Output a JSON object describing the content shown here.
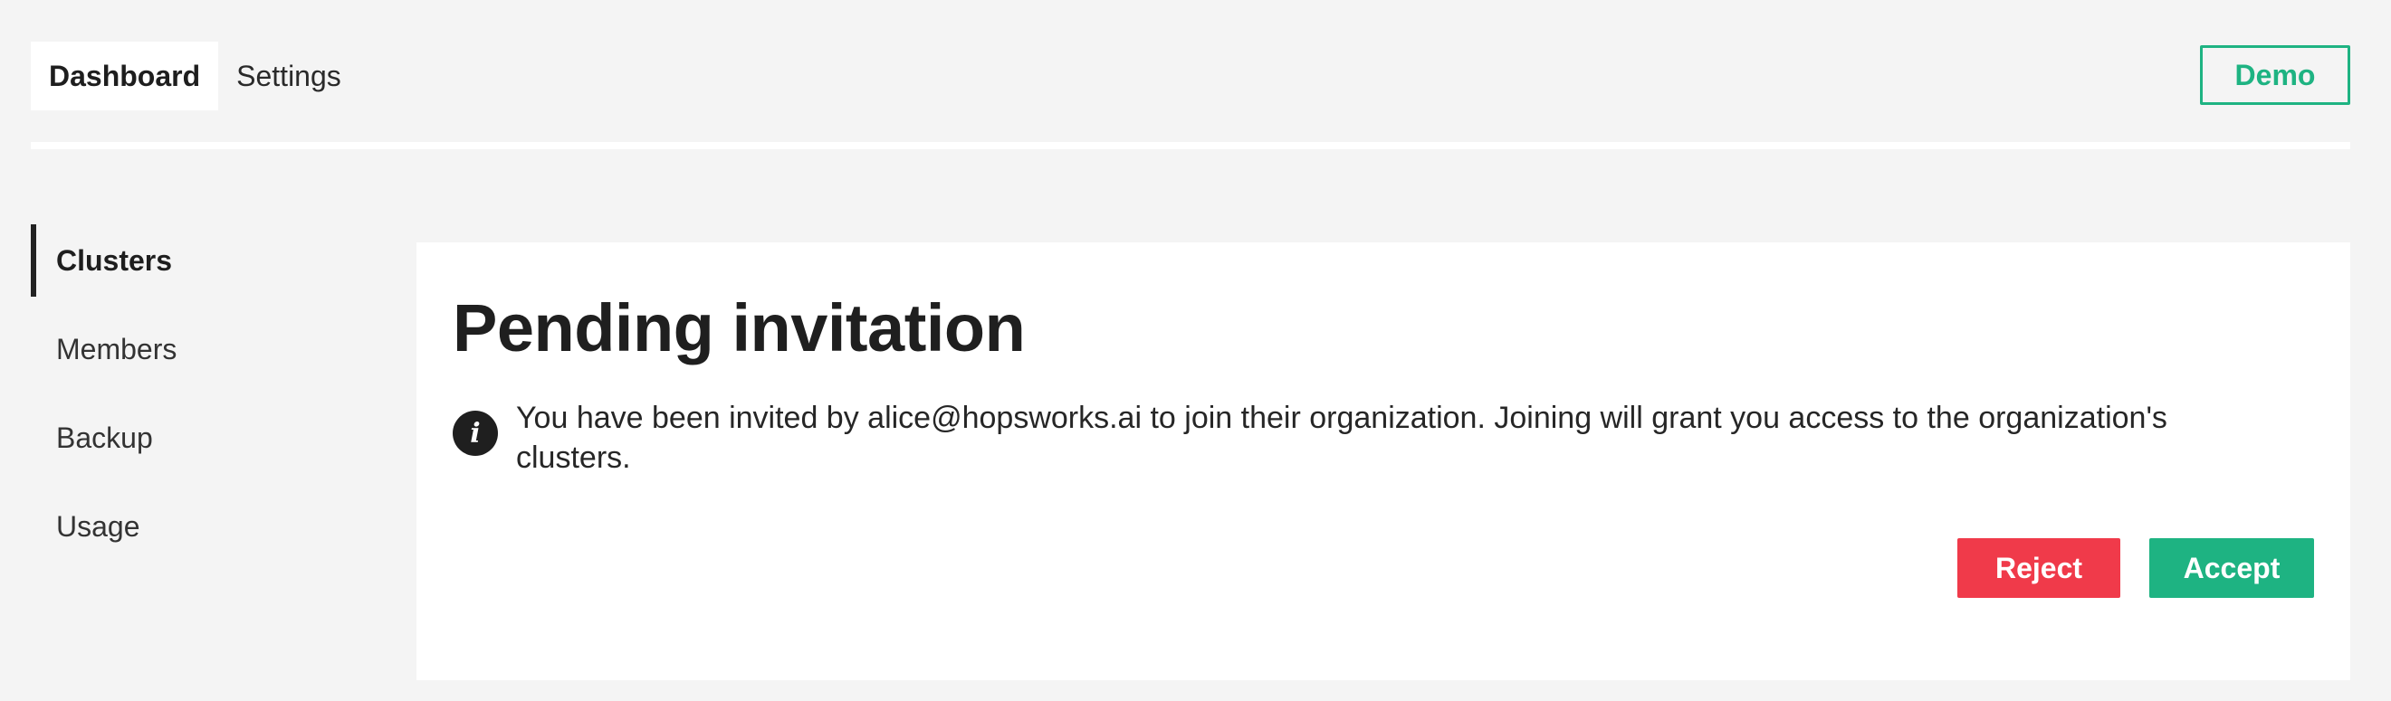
{
  "header": {
    "tabs": [
      {
        "label": "Dashboard",
        "active": true
      },
      {
        "label": "Settings",
        "active": false
      }
    ],
    "demo_label": "Demo"
  },
  "sidebar": {
    "items": [
      {
        "label": "Clusters",
        "active": true
      },
      {
        "label": "Members",
        "active": false
      },
      {
        "label": "Backup",
        "active": false
      },
      {
        "label": "Usage",
        "active": false
      }
    ]
  },
  "main": {
    "title": "Pending invitation",
    "info_icon": "info-icon",
    "message": "You have been invited by alice@hopsworks.ai to join their organization. Joining will grant you access to the organization's clusters.",
    "reject_label": "Reject",
    "accept_label": "Accept"
  },
  "colors": {
    "background": "#f4f4f4",
    "accent_green": "#1eb382",
    "reject_red": "#f03a4a",
    "text_dark": "#222222"
  }
}
